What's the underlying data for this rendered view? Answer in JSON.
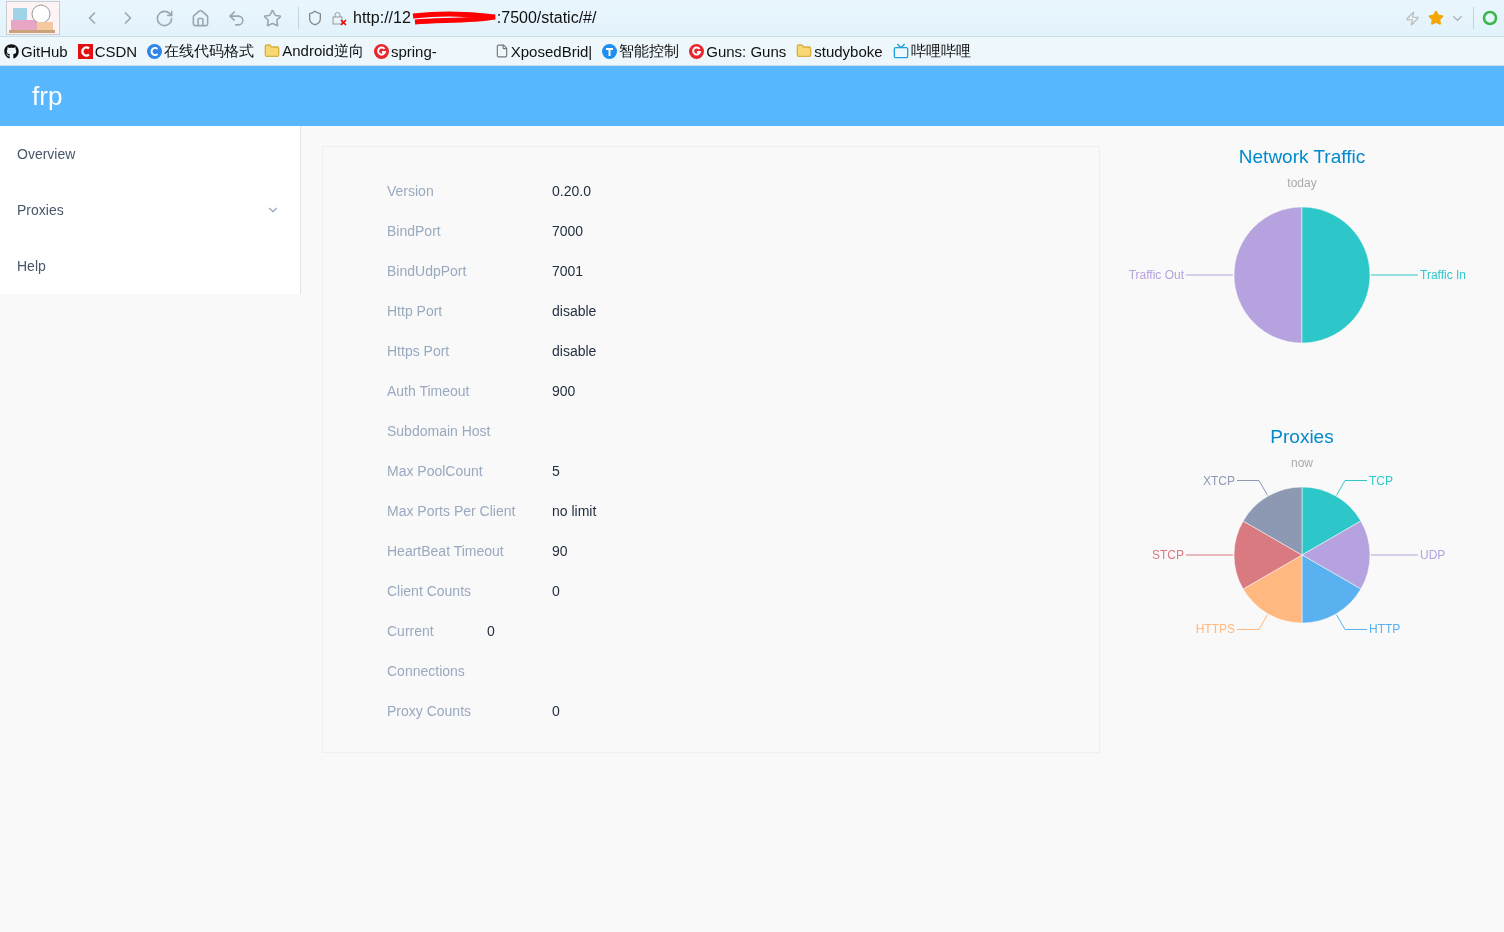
{
  "browser": {
    "url_start": "http://12",
    "url_end": ":7500/static/#/"
  },
  "bookmarks": [
    {
      "label": "GitHub",
      "kind": "github"
    },
    {
      "label": "CSDN",
      "kind": "csdn"
    },
    {
      "label": "在线代码格式",
      "kind": "bluec"
    },
    {
      "label": "Android逆向",
      "kind": "folder"
    },
    {
      "label": "spring-",
      "kind": "redg"
    },
    {
      "label": "XposedBrid|",
      "kind": "file"
    },
    {
      "label": "智能控制",
      "kind": "bluet"
    },
    {
      "label": "Guns: Guns",
      "kind": "redg"
    },
    {
      "label": "studyboke",
      "kind": "folder"
    },
    {
      "label": "哔哩哔哩",
      "kind": "tv"
    }
  ],
  "header": {
    "brand": "frp"
  },
  "sidebar": {
    "items": [
      {
        "label": "Overview",
        "expandable": false
      },
      {
        "label": "Proxies",
        "expandable": true
      },
      {
        "label": "Help",
        "expandable": false
      }
    ]
  },
  "info": [
    {
      "label": "Version",
      "value": "0.20.0"
    },
    {
      "label": "BindPort",
      "value": "7000"
    },
    {
      "label": "BindUdpPort",
      "value": "7001"
    },
    {
      "label": "Http Port",
      "value": "disable"
    },
    {
      "label": "Https Port",
      "value": "disable"
    },
    {
      "label": "Auth Timeout",
      "value": "900"
    },
    {
      "label": "Subdomain Host"
    },
    {
      "label": "Max PoolCount",
      "value": "5"
    },
    {
      "label": "Max Ports Per Client",
      "value": "no limit"
    },
    {
      "label": "HeartBeat Timeout",
      "value": "90"
    },
    {
      "label": "Client Counts",
      "value": "0"
    },
    {
      "label": "Current Connections",
      "value": "0",
      "wrapped": true
    },
    {
      "label": "Proxy Counts",
      "value": "0"
    }
  ],
  "charts": [
    {
      "title": "Network Traffic",
      "subtitle": "today",
      "slices": [
        {
          "label": "Traffic Out",
          "color": "#b6a2de"
        },
        {
          "label": "Traffic In",
          "color": "#2ec7c9"
        }
      ]
    },
    {
      "title": "Proxies",
      "subtitle": "now",
      "slices": [
        {
          "label": "TCP",
          "color": "#2ec7c9"
        },
        {
          "label": "UDP",
          "color": "#b6a2de"
        },
        {
          "label": "HTTP",
          "color": "#5ab1ef"
        },
        {
          "label": "HTTPS",
          "color": "#ffb980"
        },
        {
          "label": "STCP",
          "color": "#d87a80"
        },
        {
          "label": "XTCP",
          "color": "#8d98b3"
        }
      ]
    }
  ]
}
